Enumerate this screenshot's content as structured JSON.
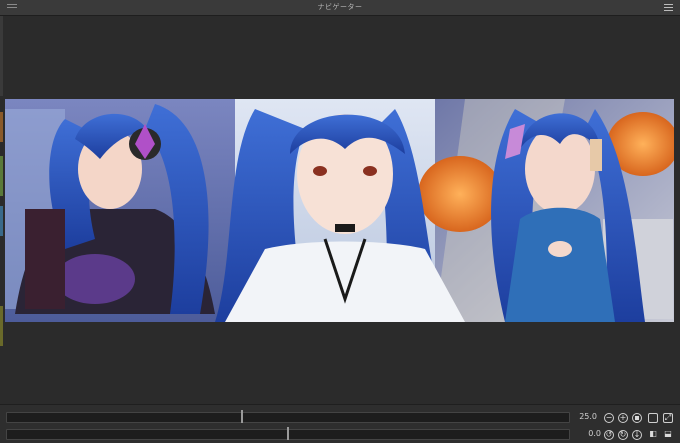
{
  "window": {
    "title": "ナビゲーター"
  },
  "controls": {
    "zoom_value": "25.0",
    "rotation_value": "0.0",
    "zoom_slider_level": 0.42,
    "rotation_slider_level": 0.5
  },
  "icons": {
    "menu": "hamburger-icon",
    "zoom_out": "minus-circle-icon",
    "zoom_in": "plus-circle-icon",
    "reset_zoom": "stop-square-icon",
    "fit": "fit-window-icon",
    "fill": "fill-window-icon",
    "rotate_left": "rotate-left-icon",
    "rotate_right": "rotate-right-icon",
    "reset_rotation": "reset-rotation-icon",
    "flip_horizontal": "flip-horizontal-icon",
    "flip_vertical": "flip-vertical-icon"
  }
}
